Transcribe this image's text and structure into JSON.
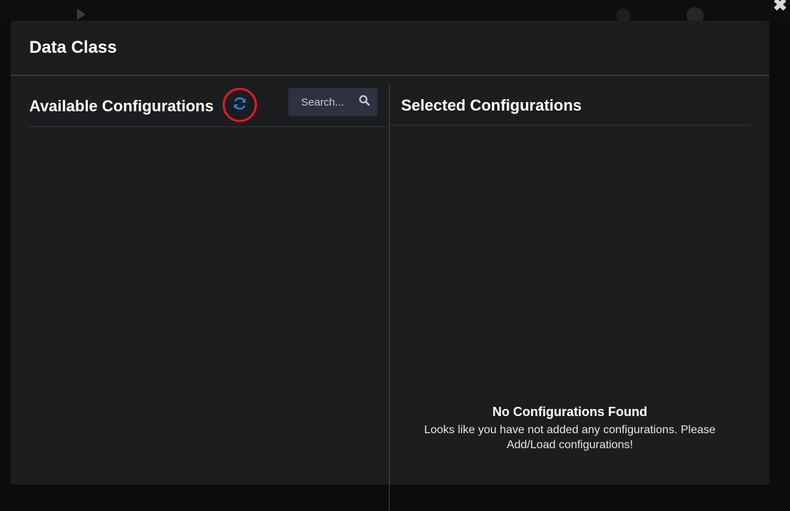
{
  "modal": {
    "title": "Data Class",
    "close_icon": "close-icon"
  },
  "available": {
    "title": "Available Configurations",
    "refresh_icon": "refresh-icon",
    "refresh_color": "#1e88e5",
    "highlight_color": "#e01b24",
    "search": {
      "placeholder": "Search...",
      "value": "",
      "icon": "search-icon"
    }
  },
  "selected": {
    "title": "Selected Configurations",
    "empty_title": "No Configurations Found",
    "empty_message": "Looks like you have not added any configurations. Please Add/Load configurations!"
  }
}
